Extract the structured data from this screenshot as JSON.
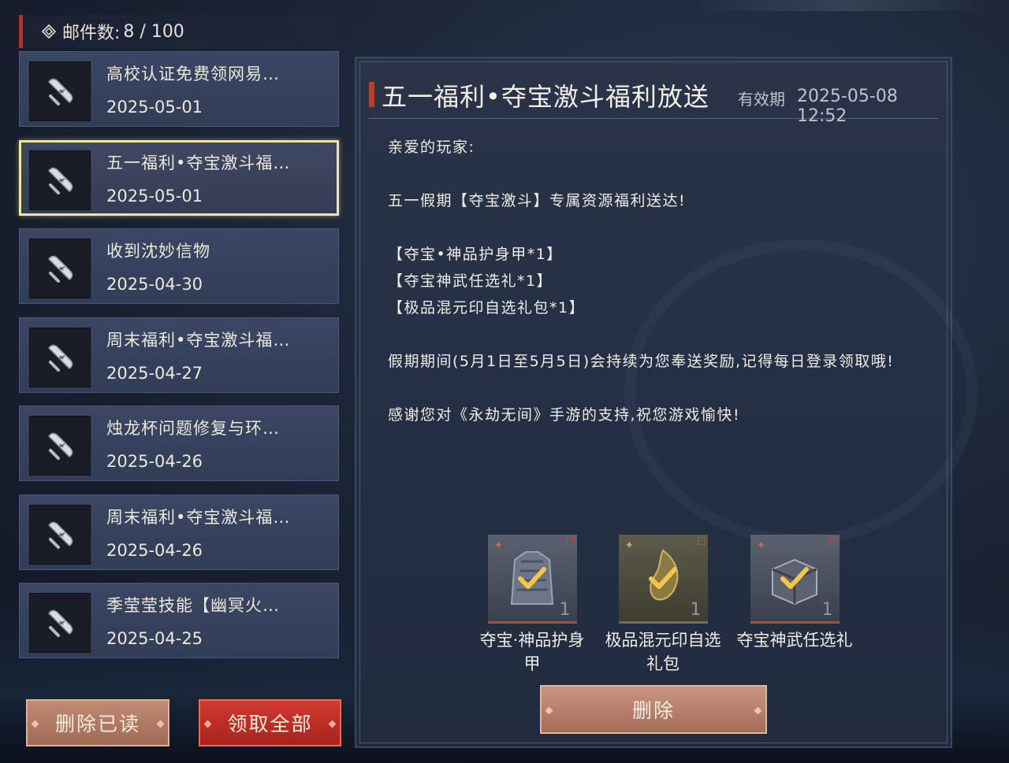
{
  "header": {
    "mail_count_label": "邮件数:",
    "mail_count_value": "8 / 100"
  },
  "mail_list": [
    {
      "title": "高校认证免费领网易…",
      "date": "2025-05-01",
      "selected": false
    },
    {
      "title": "五一福利•夺宝激斗福…",
      "date": "2025-05-01",
      "selected": true
    },
    {
      "title": "收到沈妙信物",
      "date": "2025-04-30",
      "selected": false
    },
    {
      "title": "周末福利•夺宝激斗福…",
      "date": "2025-04-27",
      "selected": false
    },
    {
      "title": "烛龙杯问题修复与环…",
      "date": "2025-04-26",
      "selected": false
    },
    {
      "title": "周末福利•夺宝激斗福…",
      "date": "2025-04-26",
      "selected": false
    },
    {
      "title": "季莹莹技能【幽冥火…",
      "date": "2025-04-25",
      "selected": false
    }
  ],
  "buttons": {
    "delete_read": "删除已读",
    "claim_all": "领取全部",
    "delete": "删除"
  },
  "detail": {
    "title": "五一福利•夺宝激斗福利放送",
    "validity_label": "有效期",
    "validity_value": "2025-05-08 12:52",
    "body": {
      "greeting": "亲爱的玩家:",
      "line1": "五一假期【夺宝激斗】专属资源福利送达!",
      "item1": "【夺宝•神品护身甲*1】",
      "item2": "【夺宝神武任选礼*1】",
      "item3": "【极品混元印自选礼包*1】",
      "line2": "假期期间(5月1日至5月5日)会持续为您奉送奖励,记得每日登录领取哦!",
      "line3": "感谢您对《永劫无间》手游的支持,祝您游戏愉快!"
    },
    "rewards": [
      {
        "name": "夺宝·神品护身甲",
        "qty": "1",
        "claimed": true
      },
      {
        "name": "极品混元印自选礼包",
        "qty": "1",
        "claimed": true
      },
      {
        "name": "夺宝神武任选礼",
        "qty": "1",
        "claimed": true
      }
    ]
  },
  "colors": {
    "accent_red": "#b3412f",
    "selected_border": "#f1e2a8",
    "claim_red": "#d2392f",
    "check_gold": "#f3c64a"
  }
}
